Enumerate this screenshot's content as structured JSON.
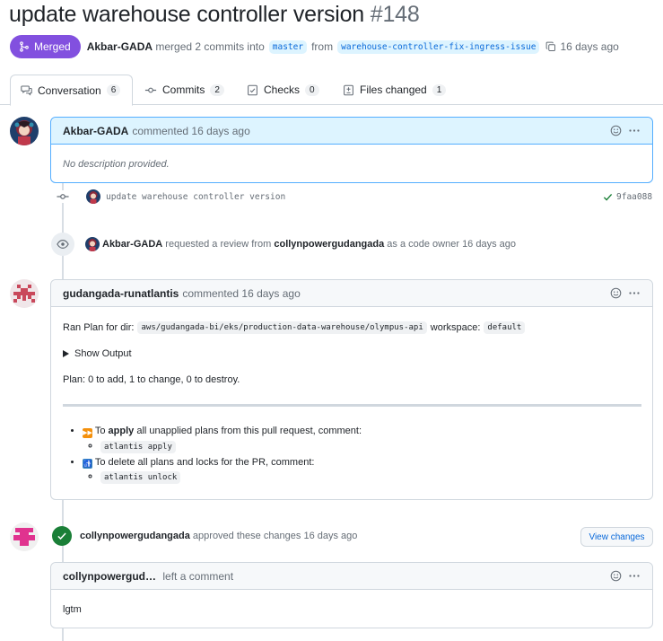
{
  "pr": {
    "title": "update warehouse controller version",
    "number": "#148",
    "status_label": "Merged",
    "author": "Akbar-GADA",
    "merge_text": "merged 2 commits into",
    "base_branch": "master",
    "from_text": "from",
    "head_branch": "warehouse-controller-fix-ingress-issue",
    "time": "16 days ago"
  },
  "tabs": [
    {
      "label": "Conversation",
      "count": "6",
      "icon": "conversation-icon"
    },
    {
      "label": "Commits",
      "count": "2",
      "icon": "commit-icon"
    },
    {
      "label": "Checks",
      "count": "0",
      "icon": "checks-icon"
    },
    {
      "label": "Files changed",
      "count": "1",
      "icon": "file-diff-icon"
    }
  ],
  "comments": {
    "first": {
      "author": "Akbar-GADA",
      "action": "commented",
      "time": "16 days ago",
      "body": "No description provided."
    },
    "atlantis": {
      "author": "gudangada-runatlantis",
      "action": "commented",
      "time": "16 days ago",
      "ran_plan_prefix": "Ran Plan for dir:",
      "dir": "aws/gudangada-bi/eks/production-data-warehouse/olympus-api",
      "workspace_label": "workspace:",
      "workspace": "default",
      "show_output": "Show Output",
      "plan_summary": "Plan: 0 to add, 1 to change, 0 to destroy.",
      "apply_prefix": "To",
      "apply_word": "apply",
      "apply_suffix": "all unapplied plans from this pull request, comment:",
      "apply_cmd": "atlantis apply",
      "unlock_text": "To delete all plans and locks for the PR, comment:",
      "unlock_cmd": "atlantis unlock"
    },
    "review": {
      "author": "collynpowergud…",
      "action": "left a comment",
      "body": "lgtm"
    }
  },
  "events": {
    "commit": {
      "message": "update warehouse controller version",
      "sha": "9faa088"
    },
    "review_request": {
      "actor": "Akbar-GADA",
      "text": "requested a review from",
      "reviewer": "collynpowergudangada",
      "suffix": "as a code owner",
      "time": "16 days ago"
    },
    "approval": {
      "actor": "collynpowergudangada",
      "text": "approved these changes",
      "time": "16 days ago",
      "button": "View changes"
    }
  },
  "colors": {
    "merged": "#8250df",
    "link": "#0969da",
    "success": "#1a7f37",
    "comment_highlight": "#ddf4ff"
  }
}
